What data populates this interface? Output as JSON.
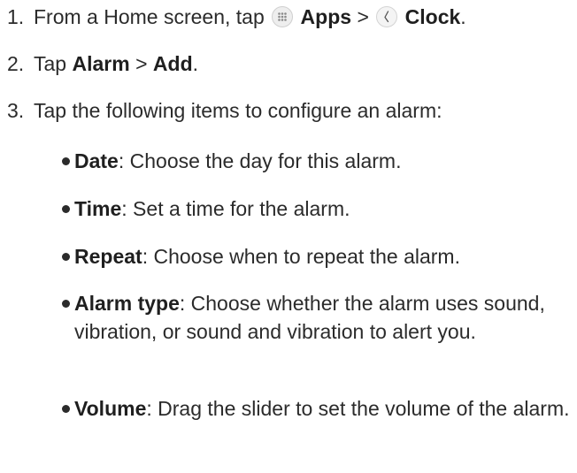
{
  "steps": [
    {
      "number": "1.",
      "prefix": "From a Home screen, tap",
      "apps_icon": "apps-grid-icon",
      "apps_label": "Apps",
      "separator": ">",
      "clock_icon": "clock-icon",
      "clock_label": "Clock",
      "suffix": "."
    },
    {
      "number": "2.",
      "prefix": "Tap",
      "alarm_label": "Alarm",
      "separator": ">",
      "add_label": "Add",
      "suffix": "."
    },
    {
      "number": "3.",
      "text": "Tap the following items to configure an alarm:"
    }
  ],
  "items": [
    {
      "term": "Date",
      "desc": ": Choose the day for this alarm."
    },
    {
      "term": "Time",
      "desc": ": Set a time for the alarm."
    },
    {
      "term": "Repeat",
      "desc": ": Choose when to repeat the alarm."
    },
    {
      "term": "Alarm type",
      "desc": ": Choose whether the alarm uses sound, vibration, or sound and vibration to alert you."
    },
    {
      "term": "Volume",
      "desc": ": Drag the slider to set the volume of the alarm."
    }
  ]
}
